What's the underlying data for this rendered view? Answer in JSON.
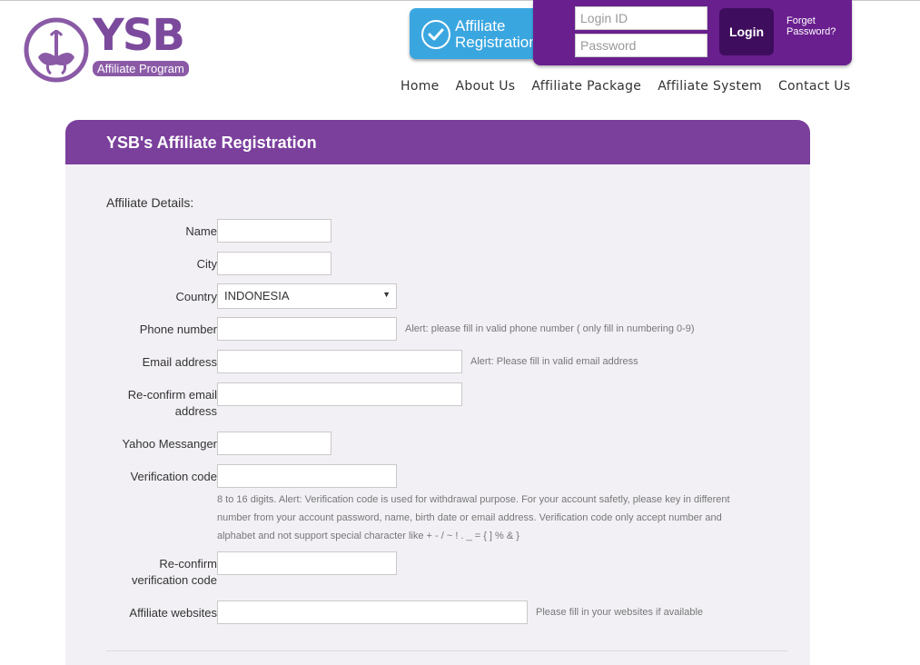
{
  "logo": {
    "brand": "YSB",
    "tagline": "Affiliate Program"
  },
  "header": {
    "registration_button": "Affiliate Registration",
    "login": {
      "id_placeholder": "Login ID",
      "password_placeholder": "Password",
      "button": "Login",
      "forget": "Forget Password?"
    },
    "nav": [
      "Home",
      "About Us",
      "Affiliate Package",
      "Affiliate System",
      "Contact Us"
    ]
  },
  "form": {
    "title": "YSB's Affiliate Registration",
    "section": "Affiliate Details:",
    "fields": {
      "name": "Name",
      "city": "City",
      "country": "Country",
      "country_value": "INDONESIA",
      "phone": "Phone number",
      "phone_hint": "Alert: please fill in valid phone number ( only fill in numbering 0-9)",
      "email": "Email address",
      "email_hint": "Alert: Please fill in valid email address",
      "reconfirm_email_1": "Re-confirm email",
      "reconfirm_email_2": "address",
      "yahoo": "Yahoo Messanger",
      "verification": "Verification code",
      "verification_note": "8 to 16 digits. Alert: Verification code is used for withdrawal purpose. For your account safetly, please key in different number from your account password, name, birth date or email address. Verification code only accept number and alphabet and not support special character like + - / ~ ! . _ = { ] % & }",
      "reconfirm_verification_1": "Re-confirm",
      "reconfirm_verification_2": "verification code",
      "websites": "Affiliate websites",
      "websites_hint": "Please fill in your websites if available"
    }
  },
  "colors": {
    "primary_purple": "#7b3f9c",
    "dark_purple": "#6a1f8f",
    "reg_blue": "#3aa6e0",
    "card_bg": "#f2f0f5"
  }
}
